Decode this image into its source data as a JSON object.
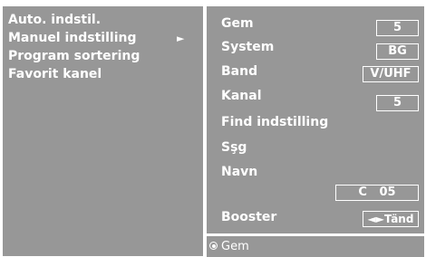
{
  "left_menu": {
    "items": [
      {
        "label": "Auto. indstil."
      },
      {
        "label": "Manuel indstilling",
        "arrow": "►"
      },
      {
        "label": "Program sortering"
      },
      {
        "label": "Favorit kanel"
      }
    ]
  },
  "settings": {
    "gem": {
      "label": "Gem",
      "value": "5"
    },
    "system": {
      "label": "System",
      "value": "BG"
    },
    "band": {
      "label": "Band",
      "value": "V/UHF"
    },
    "kanal": {
      "label": "Kanal",
      "value": "5"
    },
    "find": {
      "label": "Find indstilling"
    },
    "sog": {
      "label": "Sşg"
    },
    "navn": {
      "label": "Navn",
      "value": "C   05"
    },
    "booster": {
      "label": "Booster",
      "value": "◄►Tänd"
    }
  },
  "status": {
    "label": "Gem",
    "icon": "radio-selected-icon"
  },
  "colors": {
    "panel": "#979797",
    "text": "#ffffff"
  }
}
